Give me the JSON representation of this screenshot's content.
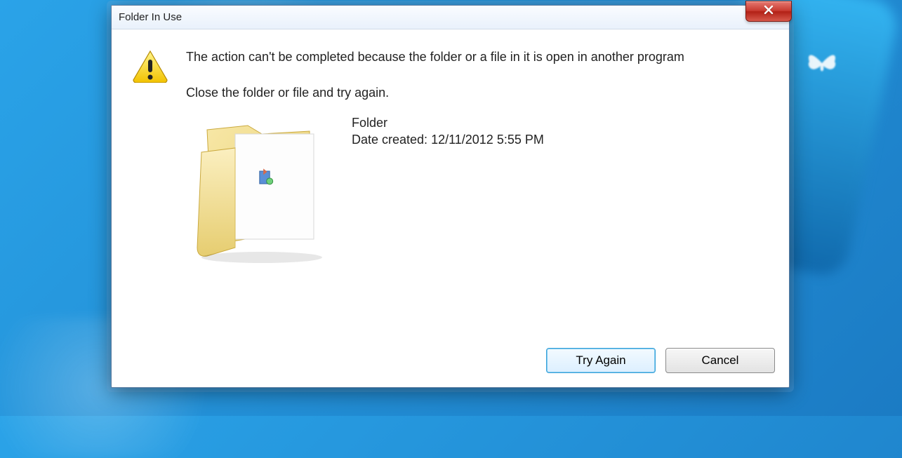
{
  "dialog": {
    "title": "Folder In Use",
    "message": "The action can't be completed because the folder or a file in it is open in another program",
    "instruction": "Close the folder or file and try again.",
    "item": {
      "name": "Folder",
      "date_created_label": "Date created: 12/11/2012 5:55 PM"
    },
    "buttons": {
      "try_again": "Try Again",
      "cancel": "Cancel"
    }
  }
}
